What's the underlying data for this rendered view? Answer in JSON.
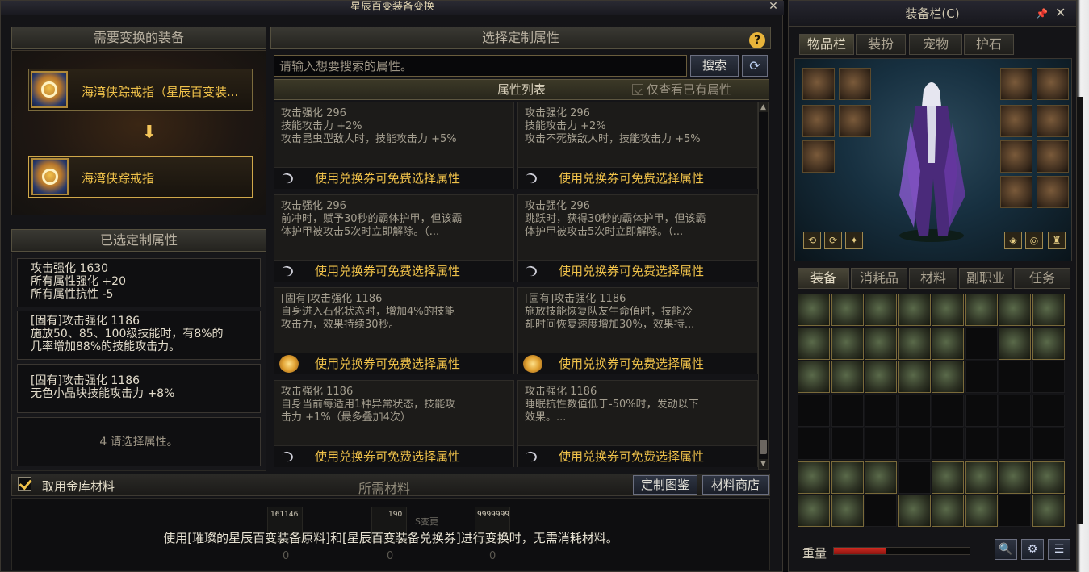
{
  "left_window": {
    "title": "星辰百变装备变换",
    "close": "✕",
    "help": "?",
    "equip_header": "需要变换的装备",
    "source_item": "海湾侠踪戒指（星辰百变装...",
    "target_item": "海湾侠踪戒指",
    "arrow": "⬇",
    "selected_header": "已选定制属性",
    "selected": [
      {
        "lines": [
          "攻击强化 1630",
          "所有属性强化 +20",
          "所有属性抗性 -5"
        ]
      },
      {
        "lines": [
          "[固有]攻击强化 1186",
          "施放50、85、100级技能时，有8%的",
          "几率增加88%的技能攻击力。"
        ]
      },
      {
        "lines": [
          "[固有]攻击强化 1186",
          "无色小晶块技能攻击力 +8%"
        ]
      }
    ],
    "selected_empty": "4 请选择属性。",
    "custom_header": "选择定制属性",
    "search_placeholder": "请输入想要搜索的属性。",
    "search_button": "搜索",
    "refresh_icon": "⟳",
    "attr_list_title": "属性列表",
    "owned_only": "仅查看已有属性",
    "voucher_text": "使用兑换券可免费选择属性",
    "cards": [
      {
        "lines": [
          "攻击强化 296",
          "技能攻击力 +2%",
          "攻击昆虫型敌人时，技能攻击力 +5%"
        ],
        "icon": "ticket"
      },
      {
        "lines": [
          "攻击强化 296",
          "技能攻击力 +2%",
          "攻击不死族敌人时，技能攻击力 +5%"
        ],
        "icon": "ticket"
      },
      {
        "lines": [
          "攻击强化 296",
          "前冲时，赋予30秒的霸体护甲，但该霸",
          "体护甲被攻击5次时立即解除。（..."
        ],
        "icon": "ticket"
      },
      {
        "lines": [
          "攻击强化 296",
          "跳跃时，获得30秒的霸体护甲，但该霸",
          "体护甲被攻击5次时立即解除。（..."
        ],
        "icon": "ticket"
      },
      {
        "lines": [
          "[固有]攻击强化 1186",
          "自身进入石化状态时，增加4%的技能",
          "攻击力，效果持续30秒。"
        ],
        "icon": "ring"
      },
      {
        "lines": [
          "[固有]攻击强化 1186",
          "施放技能恢复队友生命值时，技能冷",
          "却时间恢复速度增加30%，效果持..."
        ],
        "icon": "ring"
      },
      {
        "lines": [
          "攻击强化 1186",
          "自身当前每适用1种异常状态，技能攻",
          "击力 +1%（最多叠加4次）"
        ],
        "icon": "ticket"
      },
      {
        "lines": [
          "攻击强化 1186",
          "睡眠抗性数值低于-50%时，发动以下",
          "效果。..."
        ],
        "icon": "ticket"
      }
    ],
    "vault_label": "取用金库材料",
    "materials_label": "所需材料",
    "catalog_button": "定制图鉴",
    "shop_button": "材料商店",
    "materials": [
      {
        "count": "161146",
        "have": "0"
      },
      {
        "count": "190",
        "have": "0"
      },
      {
        "count": "9999999",
        "have": "0"
      }
    ],
    "change_label": "S变更",
    "material_note": "使用[璀璨的星辰百变装备原料]和[星辰百变装备兑换券]进行变换时，无需消耗材料。"
  },
  "right_window": {
    "title": "装备栏(C)",
    "pin": "📌",
    "close": "✕",
    "top_tabs": [
      "物品栏",
      "装扮",
      "宠物",
      "护石"
    ],
    "bottom_tabs": [
      "装备",
      "消耗品",
      "材料",
      "副职业",
      "任务"
    ],
    "weight_label": "重量",
    "weight_fraction": 0.38,
    "search_icon": "🔍",
    "settings_icon": "⚙",
    "list_icon": "☰"
  }
}
